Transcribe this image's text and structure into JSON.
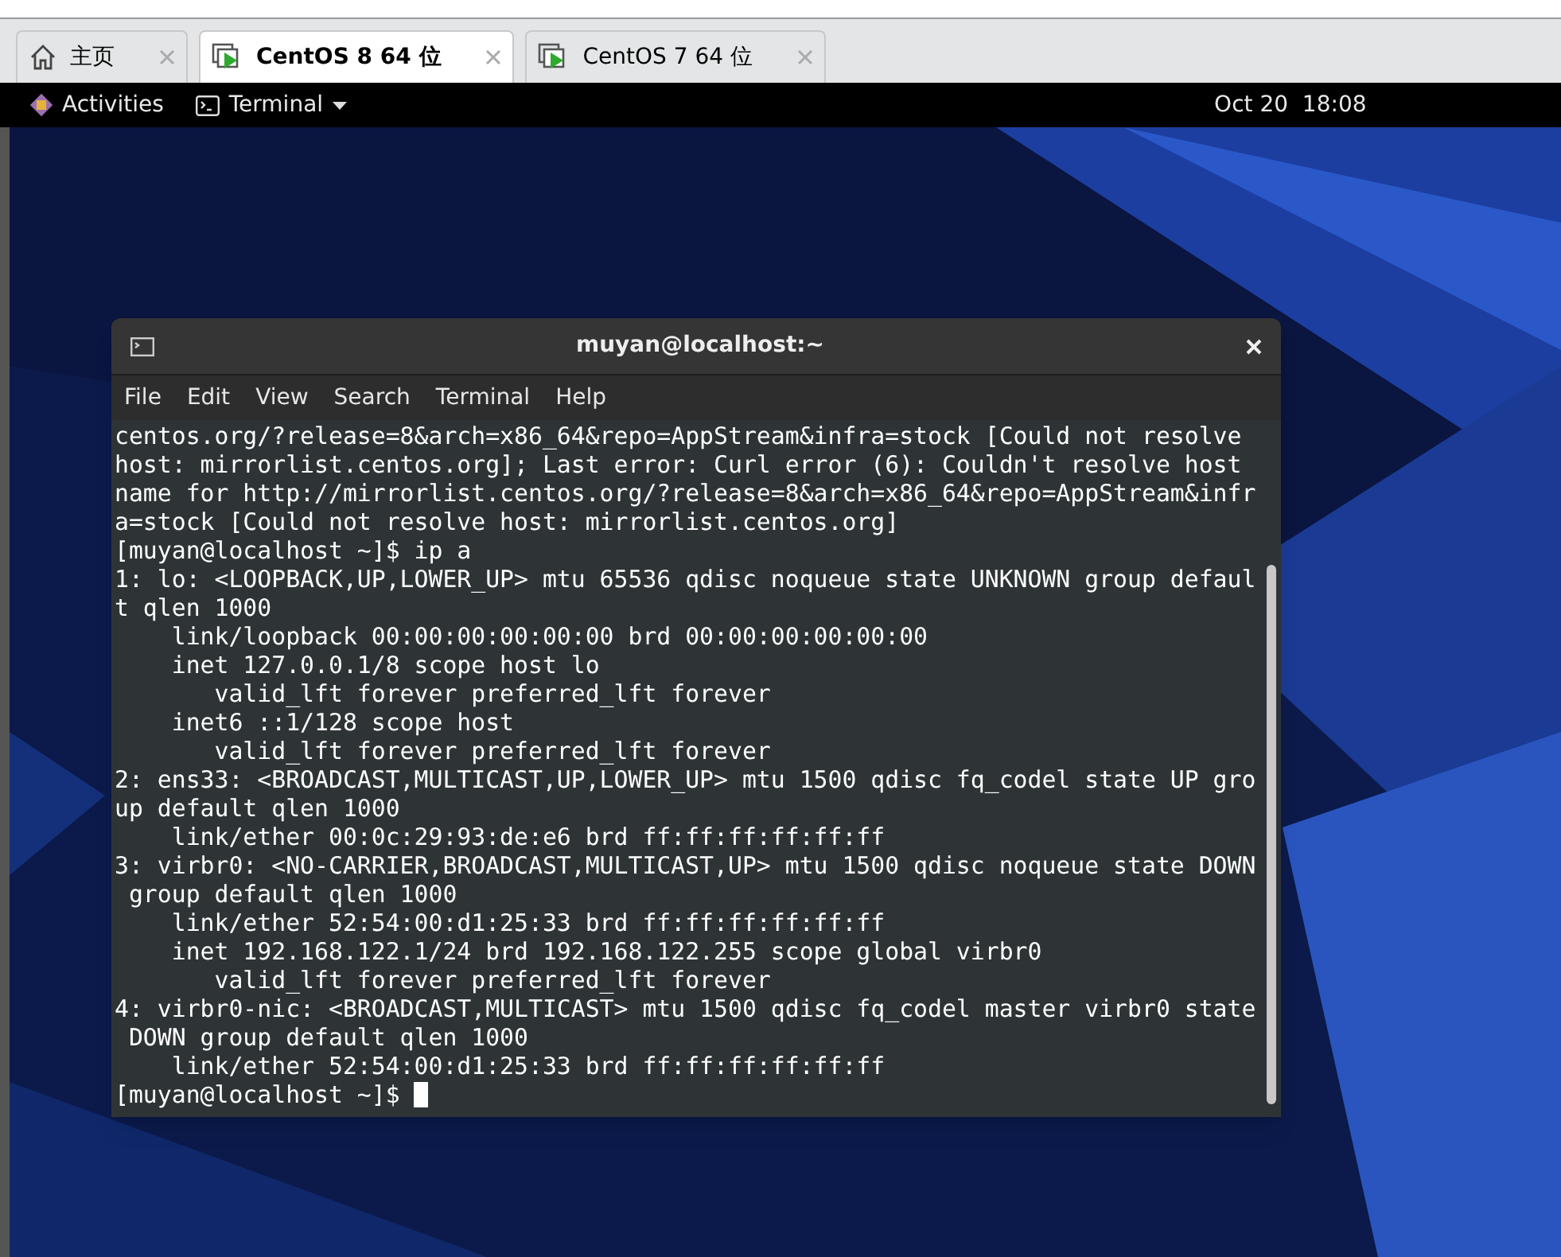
{
  "tabs": [
    {
      "label": "主页",
      "kind": "home",
      "selected": false
    },
    {
      "label": "CentOS 8 64 位",
      "kind": "vm",
      "selected": true
    },
    {
      "label": "CentOS 7 64 位",
      "kind": "vm",
      "selected": false
    }
  ],
  "top_bar": {
    "activities": "Activities",
    "app_menu": "Terminal",
    "clock": "Oct 20  18:08"
  },
  "terminal": {
    "title": "muyan@localhost:~",
    "menu": [
      "File",
      "Edit",
      "View",
      "Search",
      "Terminal",
      "Help"
    ],
    "lines": [
      "centos.org/?release=8&arch=x86_64&repo=AppStream&infra=stock [Could not resolve",
      "host: mirrorlist.centos.org]; Last error: Curl error (6): Couldn't resolve host",
      "name for http://mirrorlist.centos.org/?release=8&arch=x86_64&repo=AppStream&infr",
      "a=stock [Could not resolve host: mirrorlist.centos.org]",
      "[muyan@localhost ~]$ ip a",
      "1: lo: <LOOPBACK,UP,LOWER_UP> mtu 65536 qdisc noqueue state UNKNOWN group defaul",
      "t qlen 1000",
      "    link/loopback 00:00:00:00:00:00 brd 00:00:00:00:00:00",
      "    inet 127.0.0.1/8 scope host lo",
      "       valid_lft forever preferred_lft forever",
      "    inet6 ::1/128 scope host",
      "       valid_lft forever preferred_lft forever",
      "2: ens33: <BROADCAST,MULTICAST,UP,LOWER_UP> mtu 1500 qdisc fq_codel state UP gro",
      "up default qlen 1000",
      "    link/ether 00:0c:29:93:de:e6 brd ff:ff:ff:ff:ff:ff",
      "3: virbr0: <NO-CARRIER,BROADCAST,MULTICAST,UP> mtu 1500 qdisc noqueue state DOWN",
      " group default qlen 1000",
      "    link/ether 52:54:00:d1:25:33 brd ff:ff:ff:ff:ff:ff",
      "    inet 192.168.122.1/24 brd 192.168.122.255 scope global virbr0",
      "       valid_lft forever preferred_lft forever",
      "4: virbr0-nic: <BROADCAST,MULTICAST> mtu 1500 qdisc fq_codel master virbr0 state",
      " DOWN group default qlen 1000",
      "    link/ether 52:54:00:d1:25:33 brd ff:ff:ff:ff:ff:ff"
    ],
    "prompt": "[muyan@localhost ~]$ "
  }
}
